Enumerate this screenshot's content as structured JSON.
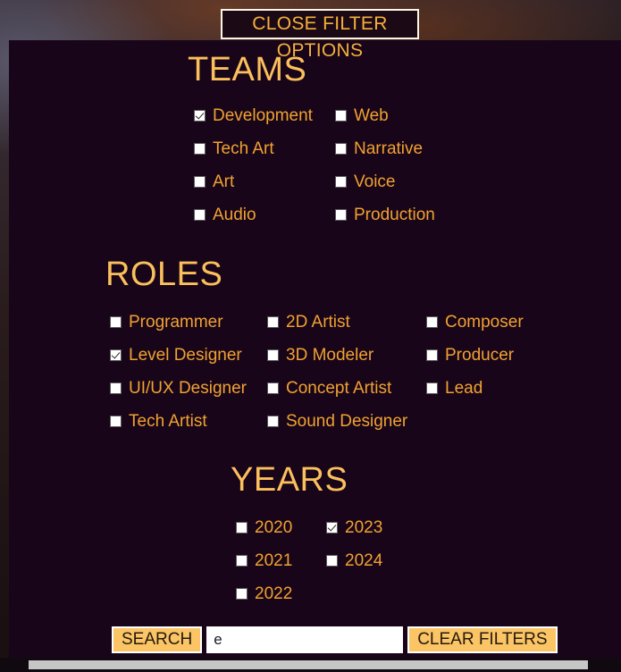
{
  "close_button": {
    "label": "CLOSE FILTER OPTIONS"
  },
  "teams": {
    "title": "TEAMS",
    "rows": [
      [
        {
          "label": "Development",
          "checked": true
        },
        {
          "label": "Web",
          "checked": false
        }
      ],
      [
        {
          "label": "Tech Art",
          "checked": false
        },
        {
          "label": "Narrative",
          "checked": false
        }
      ],
      [
        {
          "label": "Art",
          "checked": false
        },
        {
          "label": "Voice",
          "checked": false
        }
      ],
      [
        {
          "label": "Audio",
          "checked": false
        },
        {
          "label": "Production",
          "checked": false
        }
      ]
    ]
  },
  "roles": {
    "title": "ROLES",
    "rows": [
      [
        {
          "label": "Programmer",
          "checked": false
        },
        {
          "label": "2D Artist",
          "checked": false
        },
        {
          "label": "Composer",
          "checked": false
        }
      ],
      [
        {
          "label": "Level Designer",
          "checked": true
        },
        {
          "label": "3D Modeler",
          "checked": false
        },
        {
          "label": "Producer",
          "checked": false
        }
      ],
      [
        {
          "label": "UI/UX Designer",
          "checked": false
        },
        {
          "label": "Concept Artist",
          "checked": false
        },
        {
          "label": "Lead",
          "checked": false
        }
      ],
      [
        {
          "label": "Tech Artist",
          "checked": false
        },
        {
          "label": "Sound Designer",
          "checked": false
        }
      ]
    ]
  },
  "years": {
    "title": "YEARS",
    "rows": [
      [
        {
          "label": "2020",
          "checked": false
        },
        {
          "label": "2023",
          "checked": true
        }
      ],
      [
        {
          "label": "2021",
          "checked": false
        },
        {
          "label": "2024",
          "checked": false
        }
      ],
      [
        {
          "label": "2022",
          "checked": false
        }
      ]
    ]
  },
  "search_bar": {
    "search_label": "SEARCH",
    "input_value": "e",
    "input_placeholder": "",
    "clear_label": "CLEAR FILTERS"
  },
  "colors": {
    "heading": "#fbbf5c",
    "option_text": "#f0a231",
    "button_fill": "#fbc464",
    "panel_bg": "#180519",
    "accent_border": "#ffffff"
  }
}
